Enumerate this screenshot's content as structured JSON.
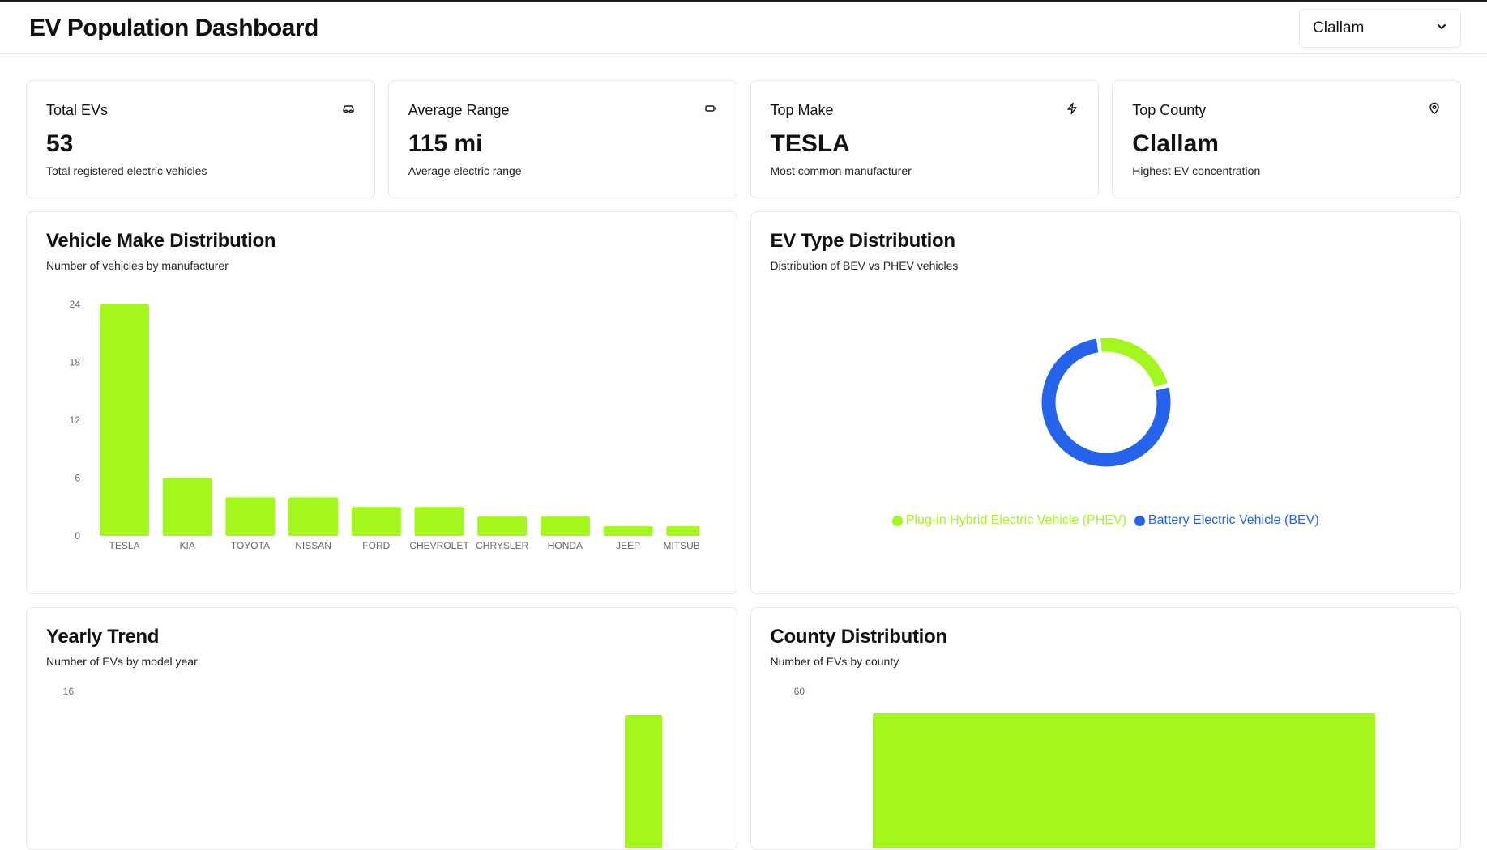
{
  "header": {
    "title": "EV Population Dashboard",
    "county_select": {
      "selected": "Clallam"
    }
  },
  "colors": {
    "accent": "#a3f71c",
    "blue": "#2563eb",
    "border": "#e5e7eb"
  },
  "stats": [
    {
      "label": "Total EVs",
      "value": "53",
      "desc": "Total registered electric vehicles",
      "icon": "car-icon"
    },
    {
      "label": "Average Range",
      "value": "115 mi",
      "desc": "Average electric range",
      "icon": "battery-icon"
    },
    {
      "label": "Top Make",
      "value": "TESLA",
      "desc": "Most common manufacturer",
      "icon": "lightning-icon"
    },
    {
      "label": "Top County",
      "value": "Clallam",
      "desc": "Highest EV concentration",
      "icon": "map-pin-icon"
    }
  ],
  "charts": {
    "make": {
      "title": "Vehicle Make Distribution",
      "subtitle": "Number of vehicles by manufacturer"
    },
    "type": {
      "title": "EV Type Distribution",
      "subtitle": "Distribution of BEV vs PHEV vehicles"
    },
    "yearly": {
      "title": "Yearly Trend",
      "subtitle": "Number of EVs by model year"
    },
    "county": {
      "title": "County Distribution",
      "subtitle": "Number of EVs by county"
    }
  },
  "chart_data": [
    {
      "type": "bar",
      "categories": [
        "TESLA",
        "KIA",
        "TOYOTA",
        "NISSAN",
        "FORD",
        "CHEVROLET",
        "CHRYSLER",
        "HONDA",
        "JEEP",
        "MITSUBISHI"
      ],
      "values": [
        24,
        6,
        4,
        4,
        3,
        3,
        2,
        2,
        1,
        1
      ],
      "yticks": [
        0,
        6,
        12,
        18,
        24
      ],
      "ylim": [
        0,
        24
      ]
    },
    {
      "type": "pie",
      "categories": [
        "Plug-in Hybrid Electric Vehicle (PHEV)",
        "Battery Electric Vehicle (BEV)"
      ],
      "values": [
        12,
        41
      ],
      "donut": true,
      "legend": "bottom"
    },
    {
      "type": "bar",
      "yticks": [
        16
      ],
      "partial": true
    },
    {
      "type": "bar",
      "yticks": [
        60
      ],
      "partial": true
    }
  ]
}
